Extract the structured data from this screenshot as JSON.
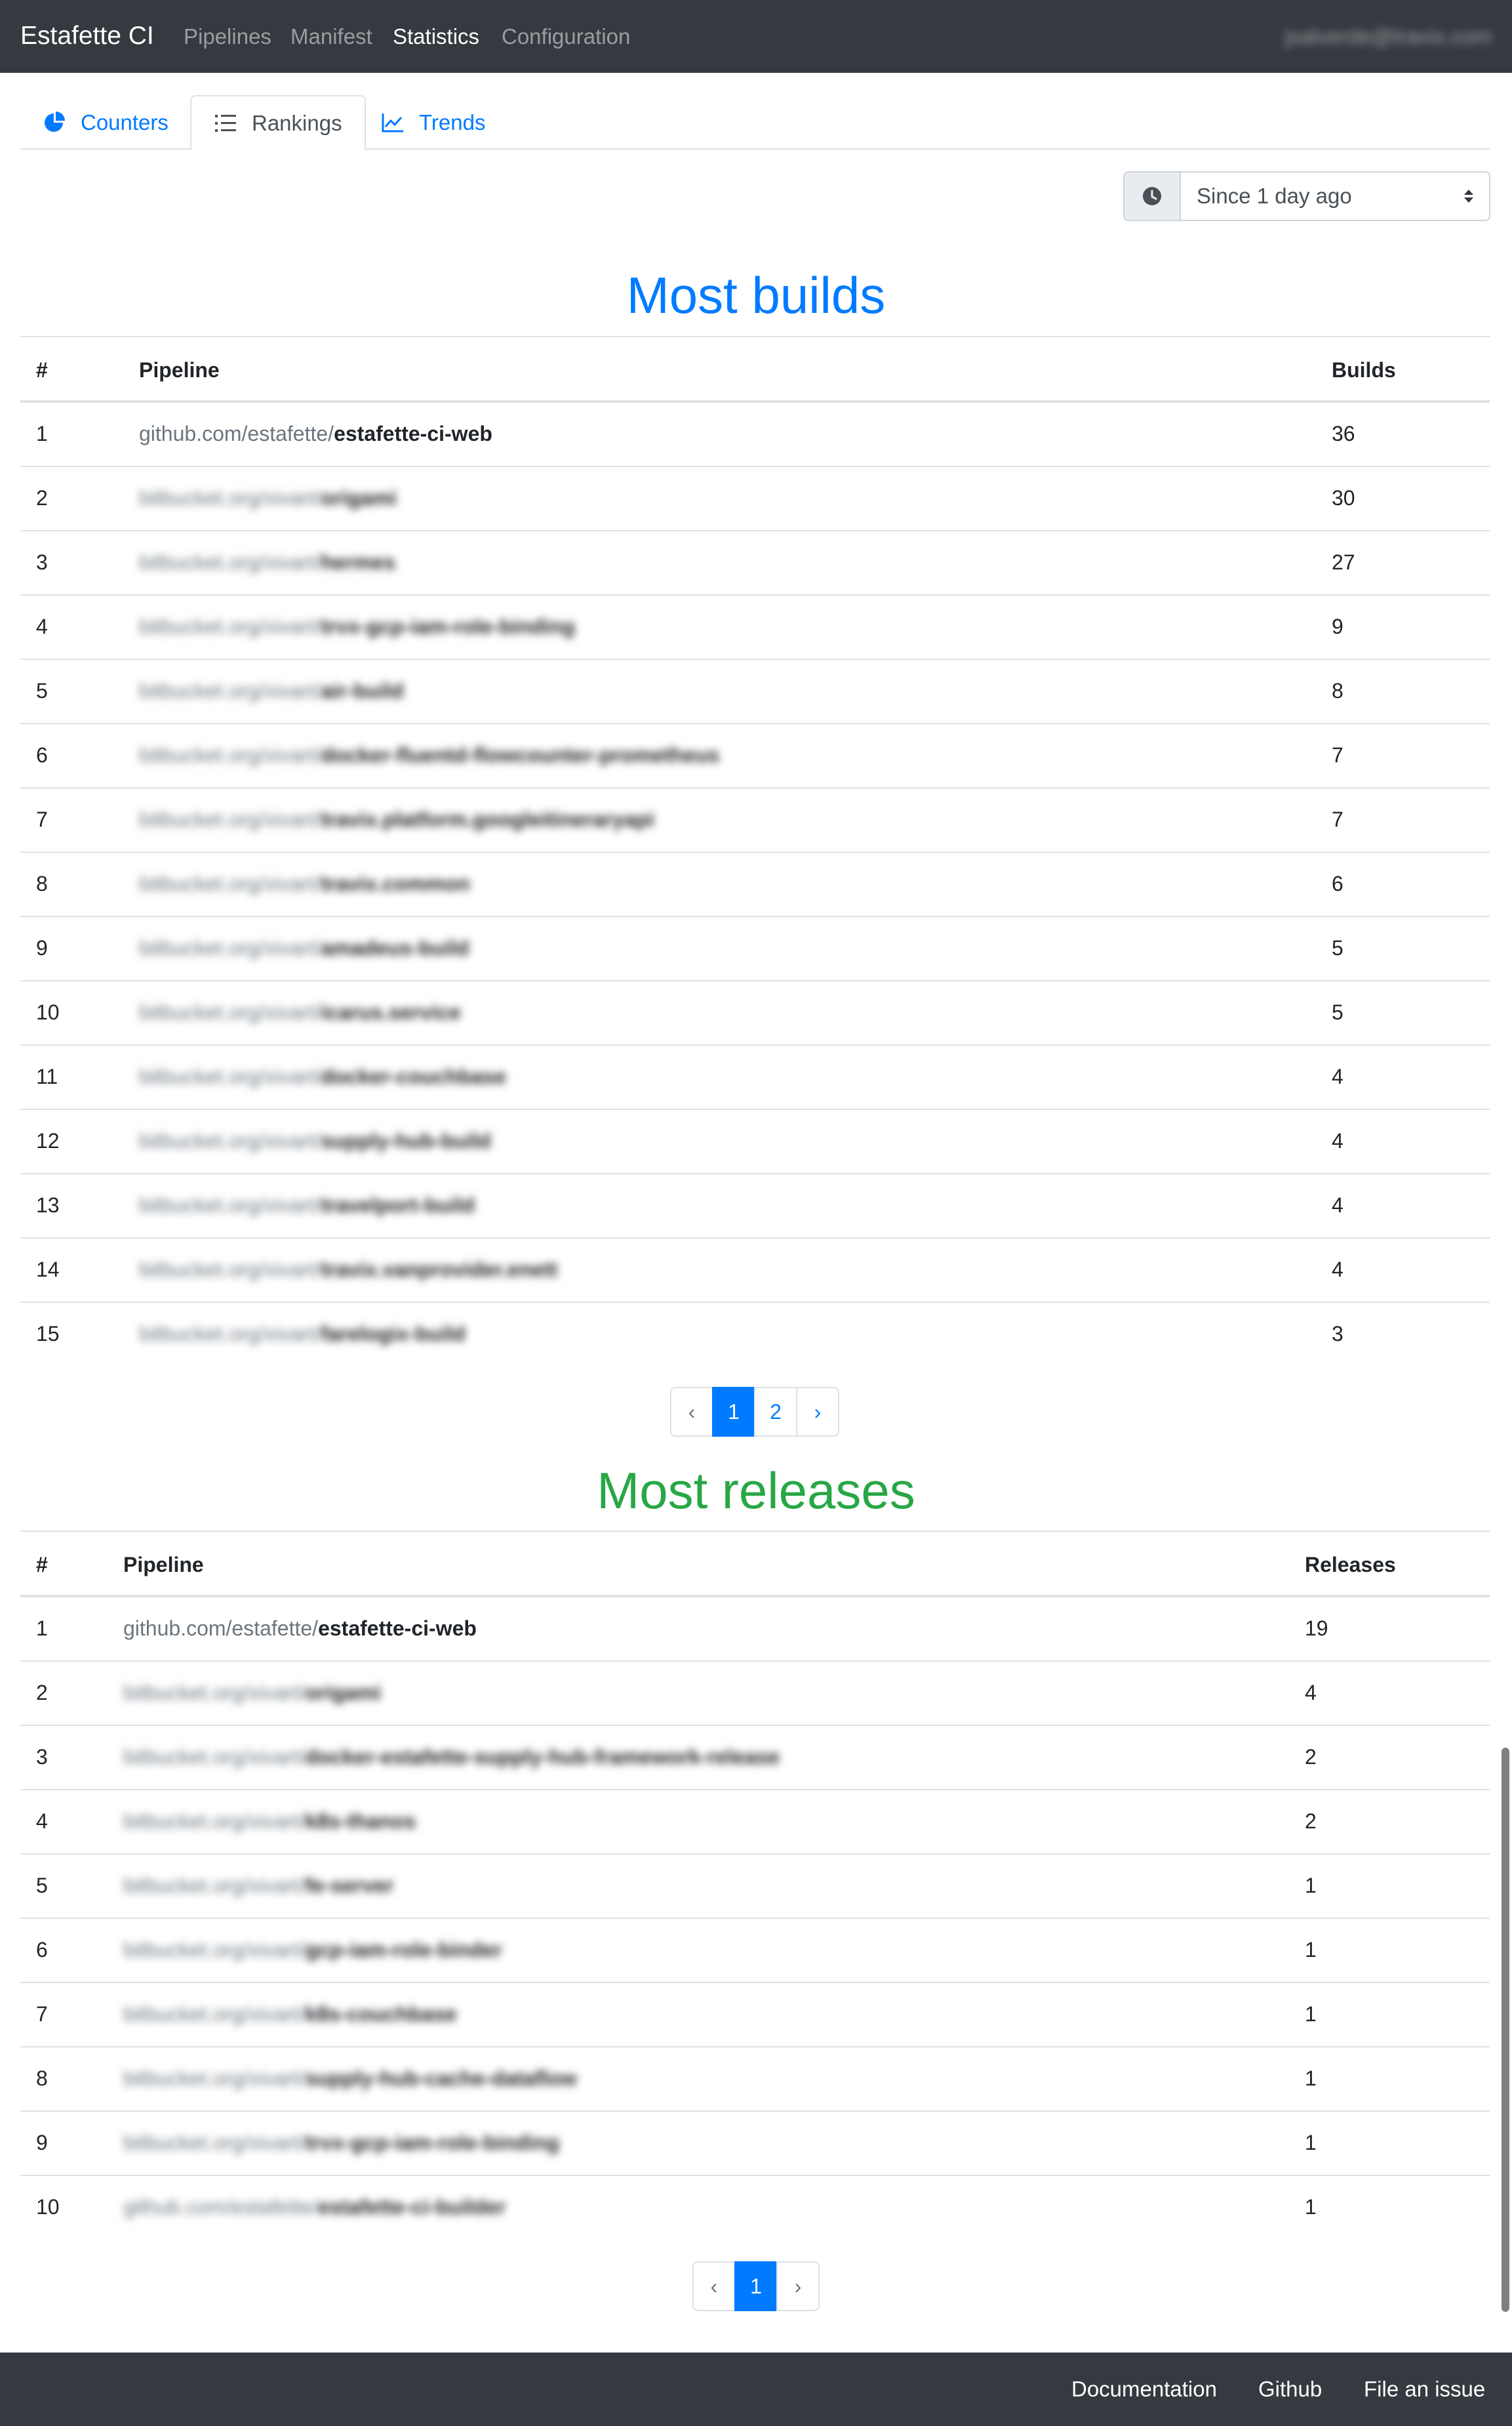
{
  "nav": {
    "brand": "Estafette CI",
    "links": [
      "Pipelines",
      "Manifest",
      "Statistics",
      "Configuration"
    ],
    "active": "Statistics",
    "user": "jsalverde@travix.com"
  },
  "tabs": [
    {
      "label": "Counters",
      "icon": "pie-chart-icon"
    },
    {
      "label": "Rankings",
      "icon": "list-ol-icon"
    },
    {
      "label": "Trends",
      "icon": "line-chart-icon"
    }
  ],
  "active_tab": "Rankings",
  "since": {
    "selected": "Since 1 day ago",
    "icon": "clock-icon"
  },
  "builds": {
    "title": "Most builds",
    "headers": {
      "rank": "#",
      "pipeline": "Pipeline",
      "count": "Builds"
    },
    "rows": [
      {
        "rank": "1",
        "prefix": "github.com/estafette/",
        "name": "estafette-ci-web",
        "count": "36"
      },
      {
        "rank": "2",
        "prefix": "bitbucket.org/xivart/",
        "name": "origami",
        "count": "30"
      },
      {
        "rank": "3",
        "prefix": "bitbucket.org/xivart/",
        "name": "hermes",
        "count": "27"
      },
      {
        "rank": "4",
        "prefix": "bitbucket.org/xivart/",
        "name": "trvx-gcp-iam-role-binding",
        "count": "9"
      },
      {
        "rank": "5",
        "prefix": "bitbucket.org/xivart/",
        "name": "air-build",
        "count": "8"
      },
      {
        "rank": "6",
        "prefix": "bitbucket.org/xivart/",
        "name": "docker-fluentd-flowcounter-prometheus",
        "count": "7"
      },
      {
        "rank": "7",
        "prefix": "bitbucket.org/xivart/",
        "name": "travix.platform.googleitineraryapi",
        "count": "7"
      },
      {
        "rank": "8",
        "prefix": "bitbucket.org/xivart/",
        "name": "travix.common",
        "count": "6"
      },
      {
        "rank": "9",
        "prefix": "bitbucket.org/xivart/",
        "name": "amadeus-build",
        "count": "5"
      },
      {
        "rank": "10",
        "prefix": "bitbucket.org/xivart/",
        "name": "icarus.service",
        "count": "5"
      },
      {
        "rank": "11",
        "prefix": "bitbucket.org/xivart/",
        "name": "docker-couchbase",
        "count": "4"
      },
      {
        "rank": "12",
        "prefix": "bitbucket.org/xivart/",
        "name": "supply-hub-build",
        "count": "4"
      },
      {
        "rank": "13",
        "prefix": "bitbucket.org/xivart/",
        "name": "travelport-build",
        "count": "4"
      },
      {
        "rank": "14",
        "prefix": "bitbucket.org/xivart/",
        "name": "travix.vanprovider.enett",
        "count": "4"
      },
      {
        "rank": "15",
        "prefix": "bitbucket.org/xivart/",
        "name": "farelogix-build",
        "count": "3"
      }
    ],
    "pages": {
      "prev": "‹",
      "items": [
        "1",
        "2"
      ],
      "next": "›",
      "current": "1"
    }
  },
  "releases": {
    "title": "Most releases",
    "headers": {
      "rank": "#",
      "pipeline": "Pipeline",
      "count": "Releases"
    },
    "rows": [
      {
        "rank": "1",
        "prefix": "github.com/estafette/",
        "name": "estafette-ci-web",
        "count": "19"
      },
      {
        "rank": "2",
        "prefix": "bitbucket.org/xivart/",
        "name": "origami",
        "count": "4"
      },
      {
        "rank": "3",
        "prefix": "bitbucket.org/xivart/",
        "name": "docker-estafette-supply-hub-framework-release",
        "count": "2"
      },
      {
        "rank": "4",
        "prefix": "bitbucket.org/xivart/",
        "name": "k8s-thanos",
        "count": "2"
      },
      {
        "rank": "5",
        "prefix": "bitbucket.org/xivart/",
        "name": "fe-server",
        "count": "1"
      },
      {
        "rank": "6",
        "prefix": "bitbucket.org/xivart/",
        "name": "gcp-iam-role-binder",
        "count": "1"
      },
      {
        "rank": "7",
        "prefix": "bitbucket.org/xivart/",
        "name": "k8s-couchbase",
        "count": "1"
      },
      {
        "rank": "8",
        "prefix": "bitbucket.org/xivart/",
        "name": "supply-hub-cache-dataflow",
        "count": "1"
      },
      {
        "rank": "9",
        "prefix": "bitbucket.org/xivart/",
        "name": "trvx-gcp-iam-role-binding",
        "count": "1"
      },
      {
        "rank": "10",
        "prefix": "github.com/estafette/",
        "name": "estafette-ci-builder",
        "count": "1"
      }
    ],
    "pages": {
      "prev": "‹",
      "items": [
        "1"
      ],
      "next": "›",
      "current": "1"
    }
  },
  "footer": {
    "links": [
      "Documentation",
      "Github",
      "File an issue"
    ]
  },
  "colors": {
    "navbar": "#343a40",
    "primary": "#007bff",
    "success": "#28a745",
    "muted": "#6c757d",
    "border": "#dee2e6"
  }
}
